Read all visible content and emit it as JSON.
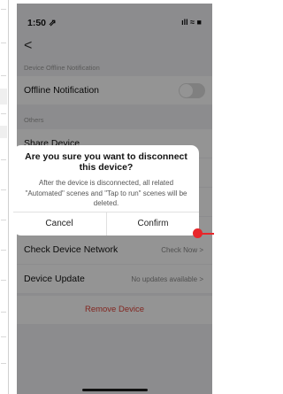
{
  "status": {
    "time": "1:50 ⇗",
    "icons": "ıll ≈ ■"
  },
  "nav": {
    "back": "<"
  },
  "sections": {
    "offline_header": "Device Offline Notification",
    "offline_row": "Offline Notification",
    "others_header": "Others",
    "share_row": "Share Device"
  },
  "rows": {
    "network_label": "Check Device Network",
    "network_value": "Check Now >",
    "update_label": "Device Update",
    "update_value": "No updates available >",
    "remove": "Remove Device"
  },
  "dialog": {
    "title": "Are you sure you want to disconnect this device?",
    "message": "After the device is disconnected, all related \"Automated\" scenes and \"Tap to run\" scenes will be deleted.",
    "cancel": "Cancel",
    "confirm": "Confirm"
  },
  "colors": {
    "accent_red": "#e8262a",
    "remove_red": "#e0443a"
  }
}
